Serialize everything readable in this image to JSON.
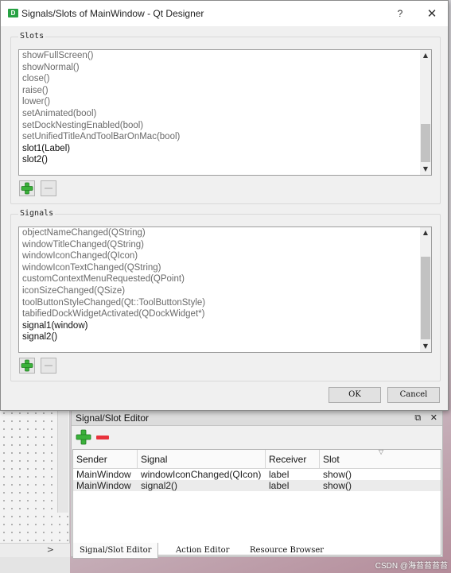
{
  "dialog": {
    "title": "Signals/Slots of MainWindow - Qt Designer",
    "app_icon_text": "D",
    "help_label": "?",
    "close_glyph": "✕",
    "slots": {
      "label": "Slots",
      "items": [
        {
          "text": "showFullScreen()",
          "own": false
        },
        {
          "text": "showNormal()",
          "own": false
        },
        {
          "text": "close()",
          "own": false
        },
        {
          "text": "raise()",
          "own": false
        },
        {
          "text": "lower()",
          "own": false
        },
        {
          "text": "setAnimated(bool)",
          "own": false
        },
        {
          "text": "setDockNestingEnabled(bool)",
          "own": false
        },
        {
          "text": "setUnifiedTitleAndToolBarOnMac(bool)",
          "own": false
        },
        {
          "text": "slot1(Label)",
          "own": true
        },
        {
          "text": "slot2()",
          "own": true
        }
      ]
    },
    "signals": {
      "label": "Signals",
      "items": [
        {
          "text": "objectNameChanged(QString)",
          "own": false
        },
        {
          "text": "windowTitleChanged(QString)",
          "own": false
        },
        {
          "text": "windowIconChanged(QIcon)",
          "own": false
        },
        {
          "text": "windowIconTextChanged(QString)",
          "own": false
        },
        {
          "text": "customContextMenuRequested(QPoint)",
          "own": false
        },
        {
          "text": "iconSizeChanged(QSize)",
          "own": false
        },
        {
          "text": "toolButtonStyleChanged(Qt::ToolButtonStyle)",
          "own": false
        },
        {
          "text": "tabifiedDockWidgetActivated(QDockWidget*)",
          "own": false
        },
        {
          "text": "signal1(window)",
          "own": true
        },
        {
          "text": "signal2()",
          "own": true
        }
      ]
    },
    "ok_label": "OK",
    "cancel_label": "Cancel"
  },
  "editor": {
    "title": "Signal/Slot Editor",
    "float_glyph": "⧉",
    "close_glyph": "✕",
    "columns": [
      "Sender",
      "Signal",
      "Receiver",
      "Slot"
    ],
    "rows": [
      {
        "sender": "MainWindow",
        "signal": "windowIconChanged(QIcon)",
        "receiver": "label",
        "slot": "show()"
      },
      {
        "sender": "MainWindow",
        "signal": "signal2()",
        "receiver": "label",
        "slot": "show()"
      }
    ],
    "tabs": [
      "Signal/Slot Editor",
      "Action Editor",
      "Resource Browser"
    ],
    "active_tab": "Signal/Slot Editor"
  },
  "background": {
    "scroll_arrow": ">"
  },
  "watermark": "CSDN @海苔苔苔苔",
  "colors": {
    "plus_green": "#3bb13b",
    "minus_red": "#e8323c",
    "own_item_text": "#0c0c0c",
    "inherited_item_text": "#6a6a6a"
  },
  "icons": {
    "add": "plus-icon",
    "remove": "minus-icon",
    "help": "question-icon",
    "close": "close-icon",
    "float": "float-icon",
    "scroll_up": "chevron-up-icon",
    "scroll_down": "chevron-down-icon"
  }
}
